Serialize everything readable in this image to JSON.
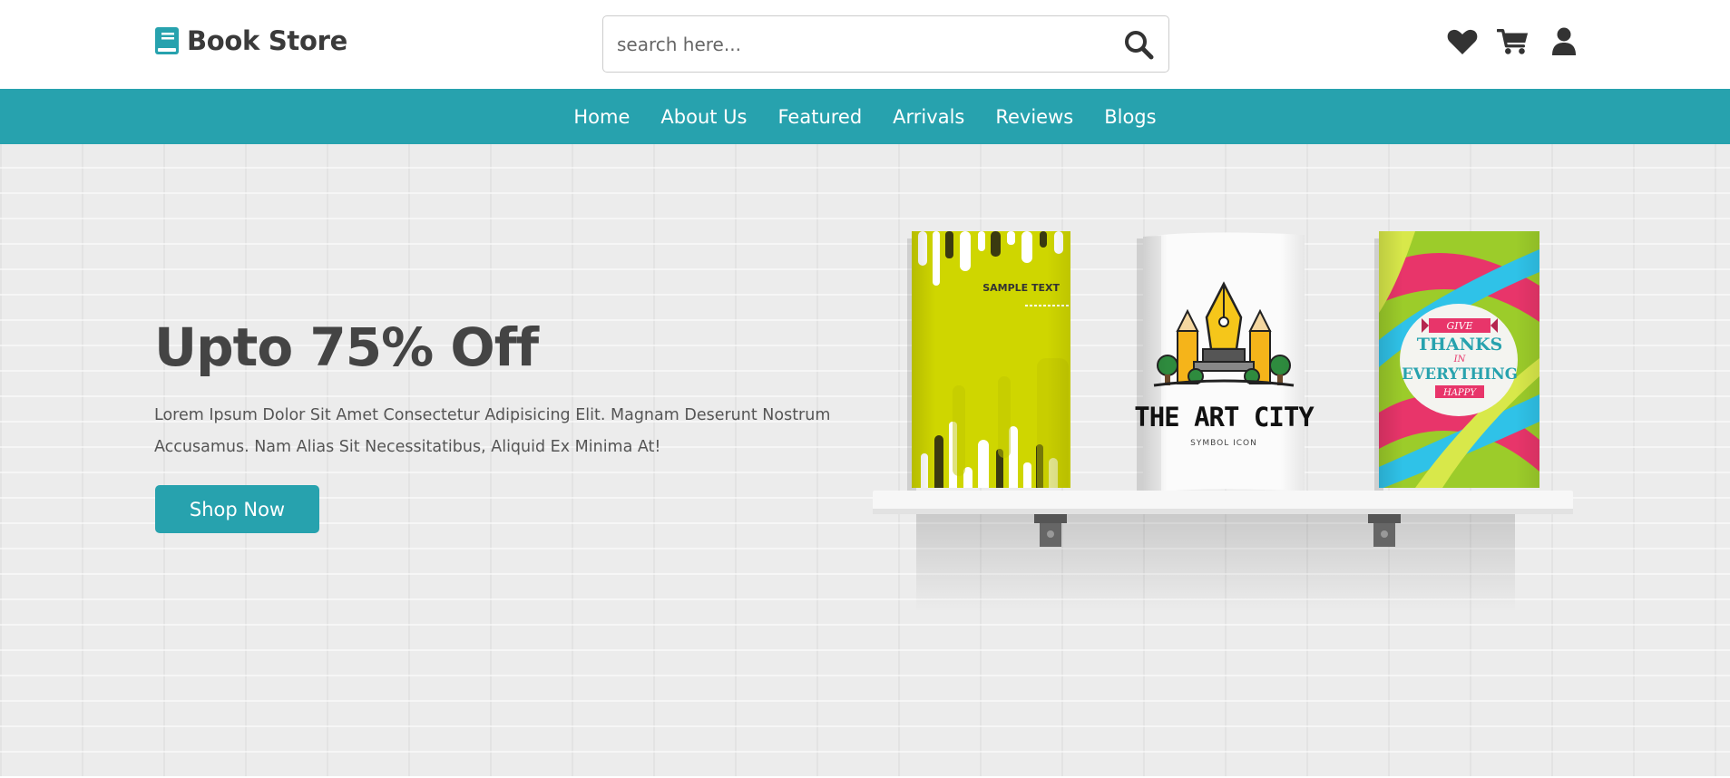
{
  "brand": {
    "name": "Book Store",
    "color": "#27a2ae"
  },
  "search": {
    "placeholder": "search here...",
    "value": "",
    "icon": "search-icon"
  },
  "header_icons": [
    {
      "name": "heart-icon",
      "label": "Wishlist"
    },
    {
      "name": "cart-icon",
      "label": "Cart"
    },
    {
      "name": "user-icon",
      "label": "Account"
    }
  ],
  "nav": {
    "items": [
      {
        "label": "Home"
      },
      {
        "label": "About Us"
      },
      {
        "label": "Featured"
      },
      {
        "label": "Arrivals"
      },
      {
        "label": "Reviews"
      },
      {
        "label": "Blogs"
      }
    ]
  },
  "hero": {
    "title": "Upto 75% Off",
    "text": "Lorem Ipsum Dolor Sit Amet Consectetur Adipisicing Elit. Magnam Deserunt Nostrum Accusamus. Nam Alias Sit Necessitatibus, Aliquid Ex Minima At!",
    "button_label": "Shop Now",
    "books": [
      {
        "name": "book-cover-sample-text",
        "text": "SAMPLE TEXT",
        "color": "#cfd600"
      },
      {
        "name": "book-cover-art-city",
        "title": "THE ART CITY",
        "subtitle": "SYMBOL ICON",
        "color": "#ffffff"
      },
      {
        "name": "book-cover-give-thanks",
        "line1": "GIVE",
        "line2": "THANKS",
        "line3": "IN",
        "line4": "EVERYTHING",
        "line5": "HAPPY",
        "color": "#9ccc2a"
      }
    ]
  },
  "colors": {
    "accent": "#27a2ae",
    "text_dark": "#444444",
    "hero_bg": "#ececec"
  }
}
